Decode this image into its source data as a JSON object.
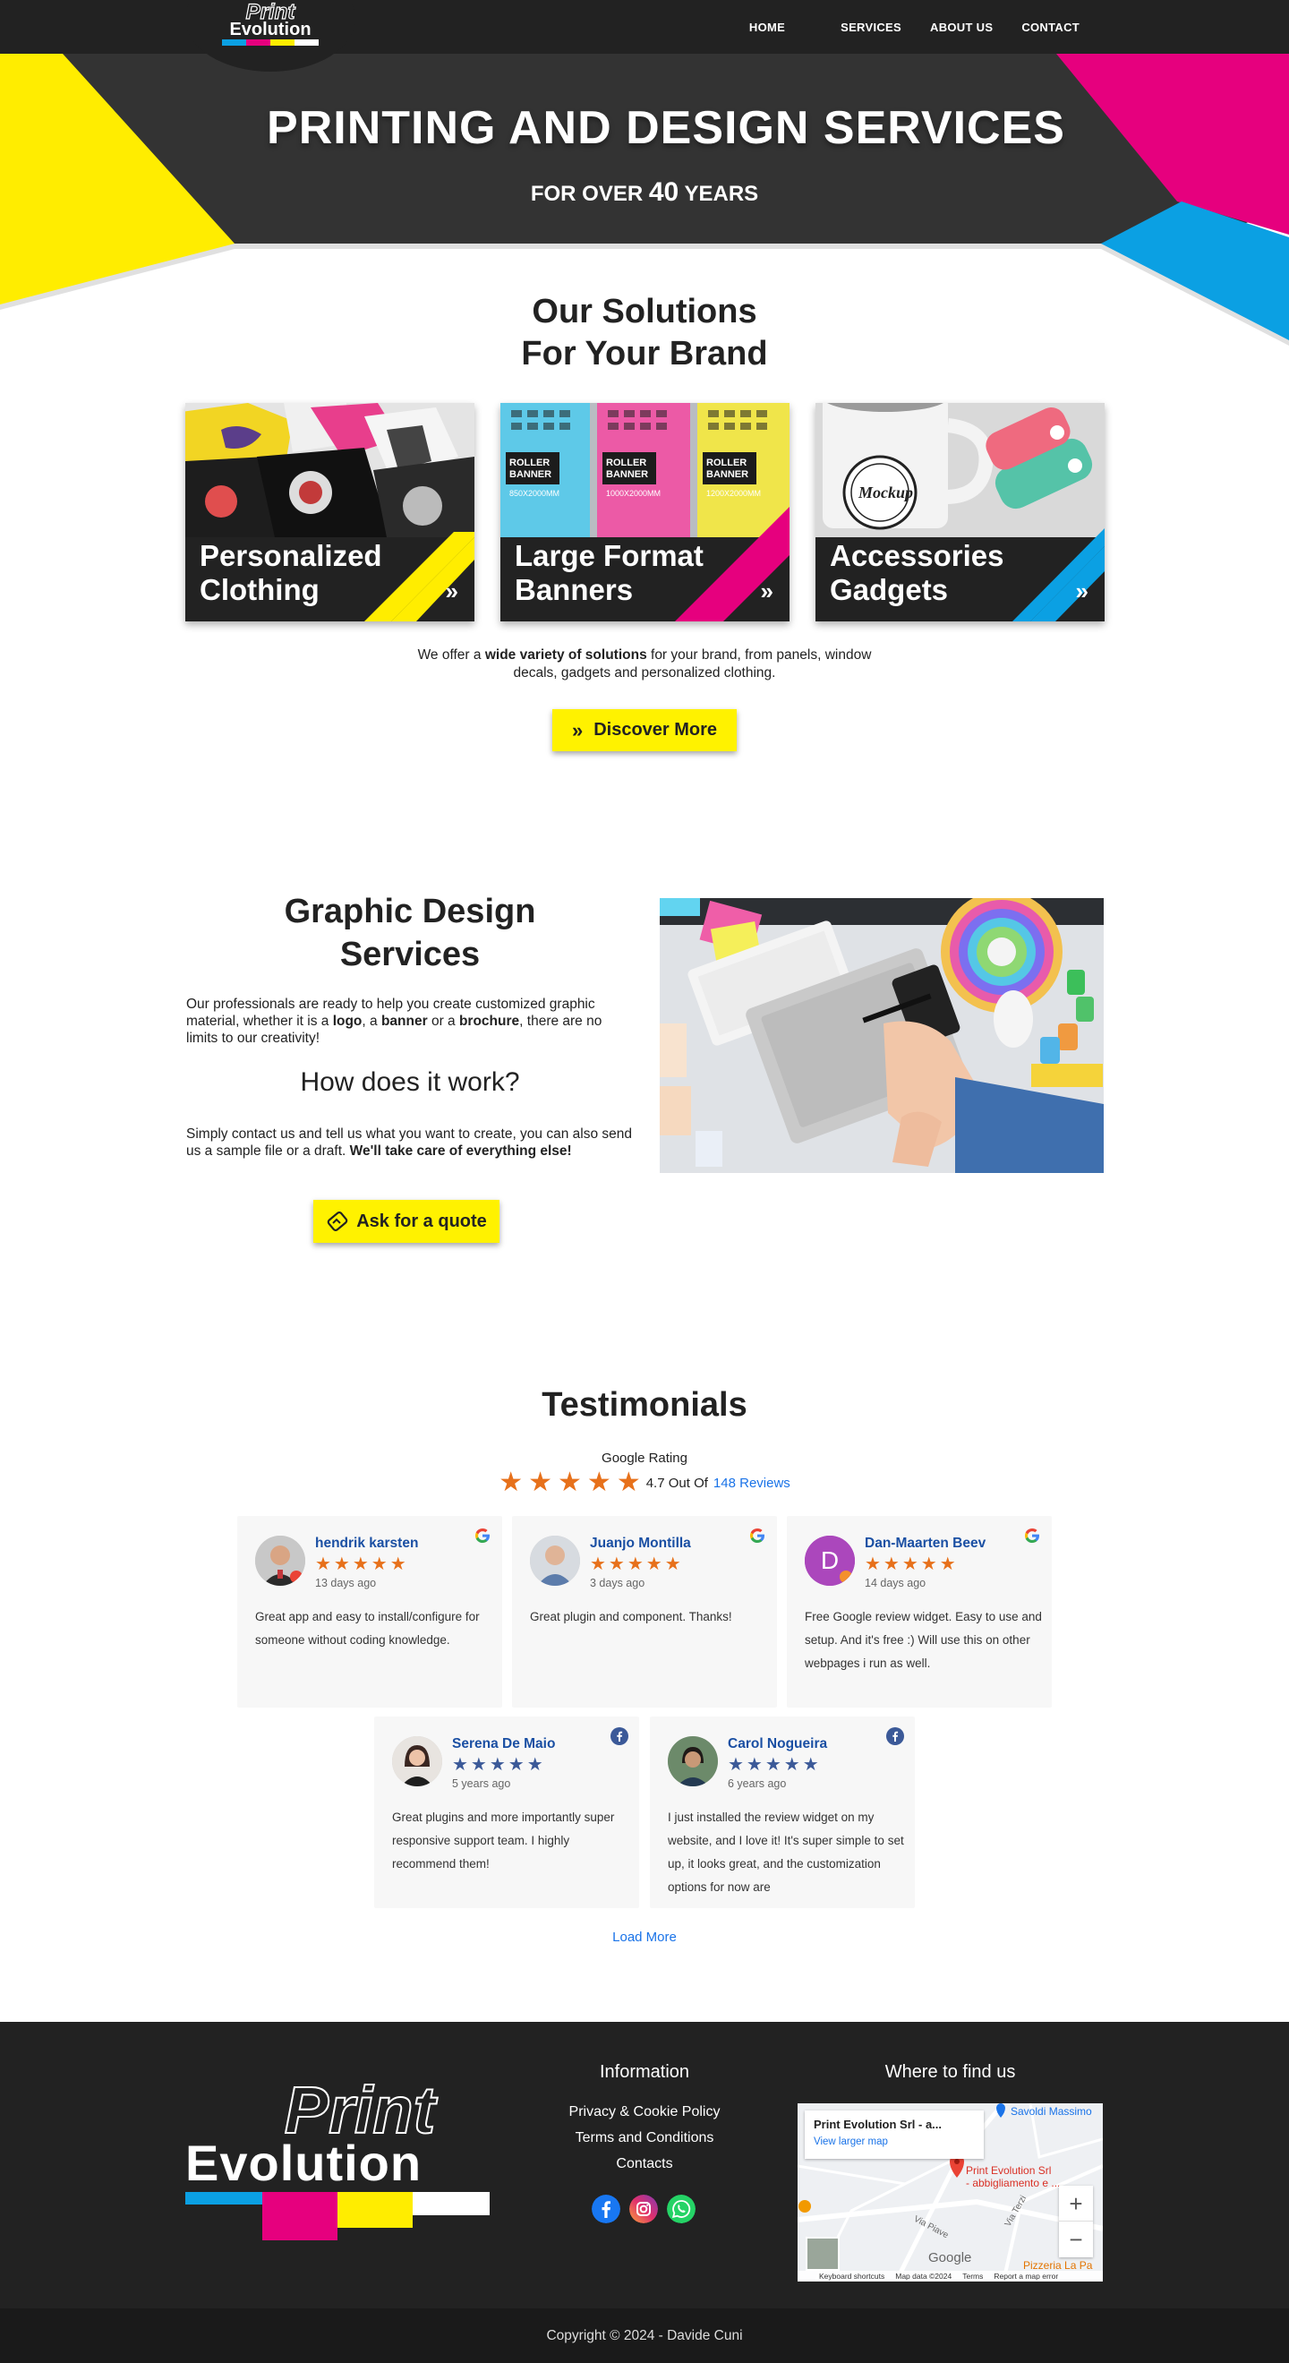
{
  "brand": {
    "logo_top": "Print",
    "logo_bottom": "Evolution",
    "colors": {
      "cyan": "#0ba0e3",
      "magenta": "#e6007e",
      "yellow": "#ffed00",
      "dark": "#222222",
      "white": "#ffffff"
    }
  },
  "nav": {
    "items": [
      {
        "label": "HOME"
      },
      {
        "label": "SERVICES"
      },
      {
        "label": "ABOUT US"
      },
      {
        "label": "CONTACT"
      }
    ]
  },
  "hero": {
    "title": "PRINTING AND DESIGN SERVICES",
    "sub_pre": "FOR OVER",
    "sub_num": "40",
    "sub_post": "YEARS"
  },
  "solutions": {
    "title_line1": "Our Solutions",
    "title_line2": "For Your Brand",
    "cards": [
      {
        "line1": "Personalized",
        "line2": "Clothing",
        "accent": "#ffed00"
      },
      {
        "line1": "Large Format",
        "line2": "Banners",
        "accent": "#e6007e"
      },
      {
        "line1": "Accessories",
        "line2": "Gadgets",
        "accent": "#0ba0e3"
      }
    ],
    "banner_label": "ROLLER BANNER",
    "banner_sizes": [
      "850X2000MM",
      "1000X2000MM",
      "1200X2000MM"
    ],
    "mug_text": "Mockup",
    "intro_pre": "We offer a ",
    "intro_bold": "wide variety of solutions",
    "intro_post": " for your brand, from panels, window decals, gadgets and personalized clothing.",
    "button": "Discover More"
  },
  "graphic": {
    "title_line1": "Graphic Design",
    "title_line2": "Services",
    "p1_a": "Our professionals are ready to help you create customized graphic material, whether it is a ",
    "p1_b": "logo",
    "p1_c": ", a ",
    "p1_d": "banner",
    "p1_e": " or a ",
    "p1_f": "brochure",
    "p1_g": ", there are no limits to our creativity!",
    "how_title": "How does it work?",
    "p2_a": "Simply contact us and tell us what you want to create, you can also send us a sample file or a draft. ",
    "p2_b": "We'll take care of everything else!",
    "button": "Ask for a quote"
  },
  "testimonials": {
    "title": "Testimonials",
    "rating_label": "Google Rating",
    "rating_text": "4.7 Out Of",
    "reviews_link": "148 Reviews",
    "rating_value": 4.7,
    "reviews": [
      {
        "name": "hendrik karsten",
        "stars": "★★★★★",
        "date": "13 days ago",
        "text": "Great app and easy to install/configure for someone without coding knowledge.",
        "source": "google"
      },
      {
        "name": "Juanjo Montilla",
        "stars": "★★★★★",
        "date": "3 days ago",
        "text": "Great plugin and component. Thanks!",
        "source": "google"
      },
      {
        "name": "Dan-Maarten Beev",
        "stars": "★★★★★",
        "date": "14 days ago",
        "text": "Free Google review widget. Easy to use and setup. And it's free :) Will use this on other webpages i run as well.",
        "source": "google",
        "initial": "D"
      },
      {
        "name": "Serena De Maio",
        "stars": "★★★★★",
        "date": "5 years ago",
        "text": "Great plugins and more importantly super responsive support team. I highly recommend them!",
        "source": "facebook"
      },
      {
        "name": "Carol Nogueira",
        "stars": "★★★★★",
        "date": "6 years ago",
        "text": "I just installed the review widget on my website, and I love it! It's super simple to set up, it looks great, and the customization options for now are",
        "source": "facebook"
      }
    ],
    "load_more": "Load More"
  },
  "footer": {
    "info_title": "Information",
    "links": [
      "Privacy & Cookie Policy",
      "Terms and Conditions",
      "Contacts"
    ],
    "map_title": "Where to find us",
    "map": {
      "place": "Print Evolution Srl - a...",
      "larger": "View larger map",
      "pin_label_1": "Print Evolution Srl",
      "pin_label_2": "- abbigliamento e ...",
      "poi_1": "Savoldi Massimo",
      "poi_2": "Pizzeria La Pa",
      "street_1": "Via Piave",
      "street_2": "Via Terzi",
      "google": "Google",
      "shortcuts": "Keyboard shortcuts",
      "map_data": "Map data ©2024",
      "terms": "Terms",
      "report": "Report a map error",
      "zoom_in": "+",
      "zoom_out": "−"
    },
    "social": [
      "facebook-icon",
      "instagram-icon",
      "whatsapp-icon"
    ]
  },
  "copyright": "Copyright © 2024 - Davide Cuni"
}
